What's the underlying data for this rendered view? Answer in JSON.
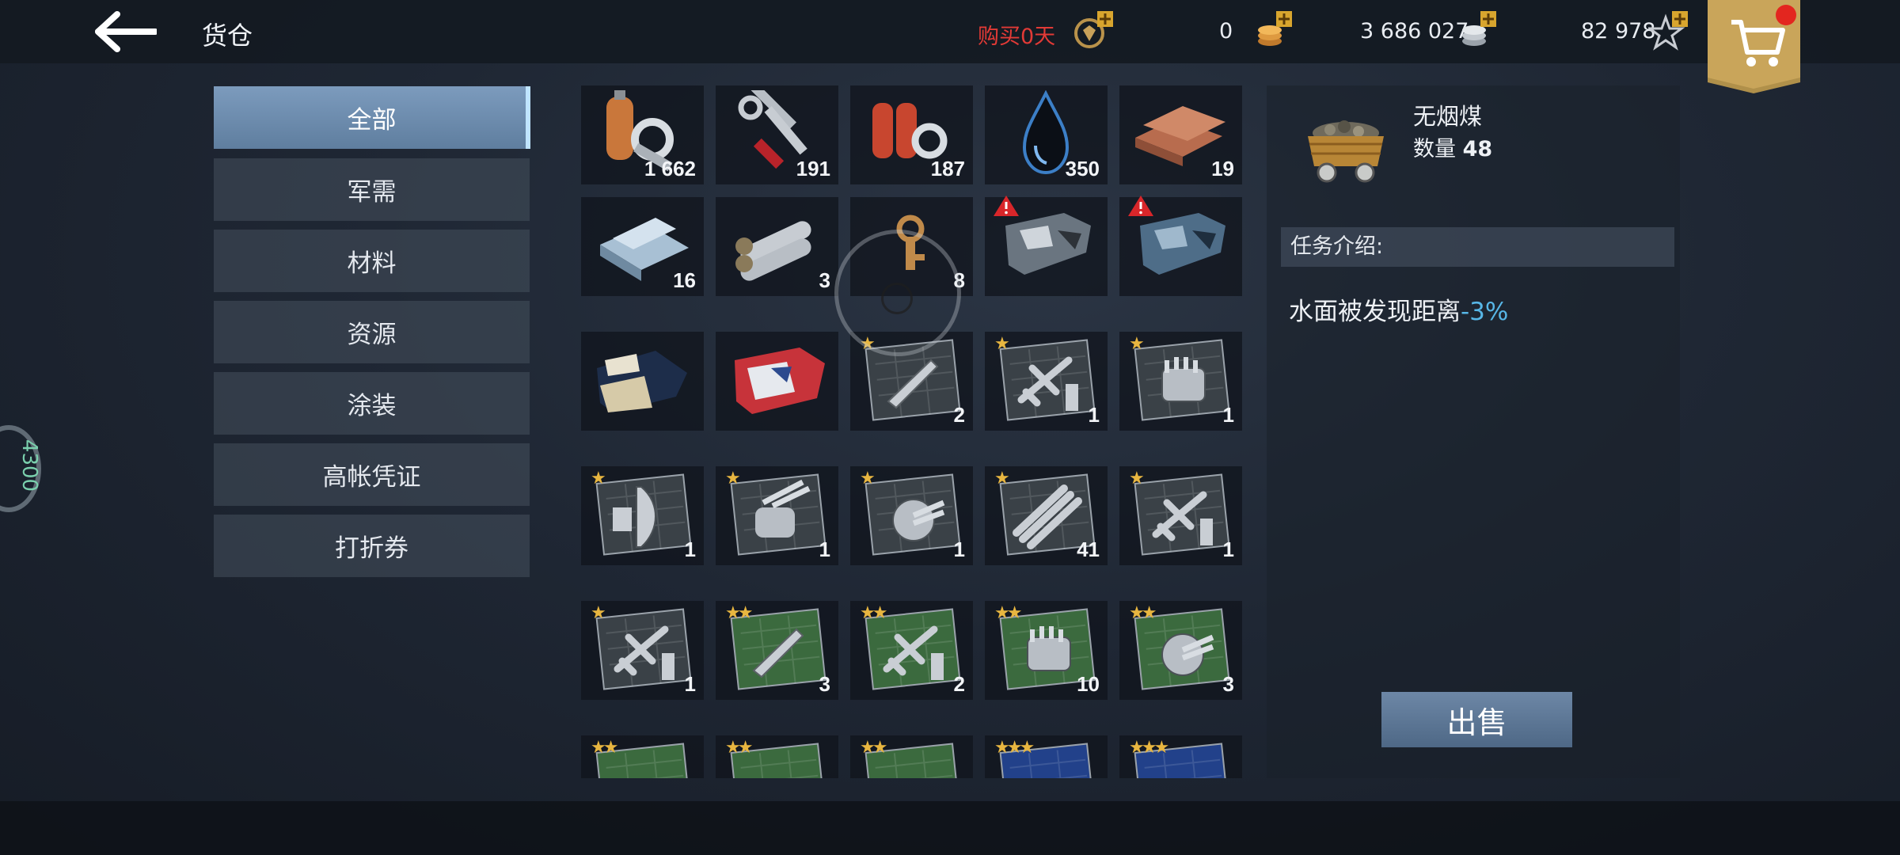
{
  "header": {
    "title": "货仓",
    "buy_premium": "购买0天",
    "gold": "0",
    "silver": "3 686 027",
    "stars": "82 978"
  },
  "categories": [
    "全部",
    "军需",
    "材料",
    "资源",
    "涂装",
    "高帐凭证",
    "打折券"
  ],
  "items": [
    {
      "icon": "oxygen-wrench-icon",
      "qty": "1 662",
      "stars": 0
    },
    {
      "icon": "tools-icon",
      "qty": "191",
      "stars": 0
    },
    {
      "icon": "tanks-wrench-icon",
      "qty": "187",
      "stars": 0
    },
    {
      "icon": "oil-drop-icon",
      "qty": "350",
      "stars": 0
    },
    {
      "icon": "copper-ingots-icon",
      "qty": "19",
      "stars": 0
    },
    {
      "icon": "steel-beams-icon",
      "qty": "16",
      "stars": 0
    },
    {
      "icon": "steel-pipes-icon",
      "qty": "3",
      "stars": 0
    },
    {
      "icon": "key-icon",
      "qty": "8",
      "stars": 0
    },
    {
      "icon": "camo-gray-icon",
      "qty": "",
      "stars": 0,
      "warning": true
    },
    {
      "icon": "camo-blue-icon",
      "qty": "",
      "stars": 0,
      "warning": true
    },
    {
      "icon": "camo-desert-icon",
      "qty": "",
      "stars": 0
    },
    {
      "icon": "camo-flag-icon",
      "qty": "",
      "stars": 0
    },
    {
      "icon": "ship-blueprint-icon",
      "qty": "2",
      "stars": 1
    },
    {
      "icon": "plane-blueprint-icon",
      "qty": "1",
      "stars": 1
    },
    {
      "icon": "turret-blueprint-icon",
      "qty": "1",
      "stars": 1
    },
    {
      "icon": "radar-blueprint-icon",
      "qty": "1",
      "stars": 1
    },
    {
      "icon": "gun-blueprint-icon",
      "qty": "1",
      "stars": 1
    },
    {
      "icon": "aa-gun-blueprint-icon",
      "qty": "1",
      "stars": 1
    },
    {
      "icon": "missile-blueprint-icon",
      "qty": "41",
      "stars": 1
    },
    {
      "icon": "plane-blueprint-icon",
      "qty": "1",
      "stars": 1
    },
    {
      "icon": "plane-blueprint-icon",
      "qty": "1",
      "stars": 1
    },
    {
      "icon": "ship-blueprint-icon",
      "qty": "3",
      "stars": 2
    },
    {
      "icon": "plane-blueprint-icon",
      "qty": "2",
      "stars": 2
    },
    {
      "icon": "turret-blueprint-icon",
      "qty": "10",
      "stars": 2
    },
    {
      "icon": "aa-gun-blueprint-icon",
      "qty": "3",
      "stars": 2
    },
    {
      "icon": "blueprint-icon",
      "qty": "",
      "stars": 2
    },
    {
      "icon": "blueprint-icon",
      "qty": "",
      "stars": 2
    },
    {
      "icon": "blueprint-icon",
      "qty": "",
      "stars": 2
    },
    {
      "icon": "blueprint-icon",
      "qty": "",
      "stars": 3
    },
    {
      "icon": "blueprint-icon",
      "qty": "",
      "stars": 3
    }
  ],
  "detail": {
    "name": "无烟煤",
    "qty_label": "数量",
    "qty": "48",
    "task_heading": "任务介绍:",
    "effect_text": "水面被发现距离",
    "effect_value": "-3%",
    "sell_label": "出售"
  },
  "side_badge": "4300"
}
